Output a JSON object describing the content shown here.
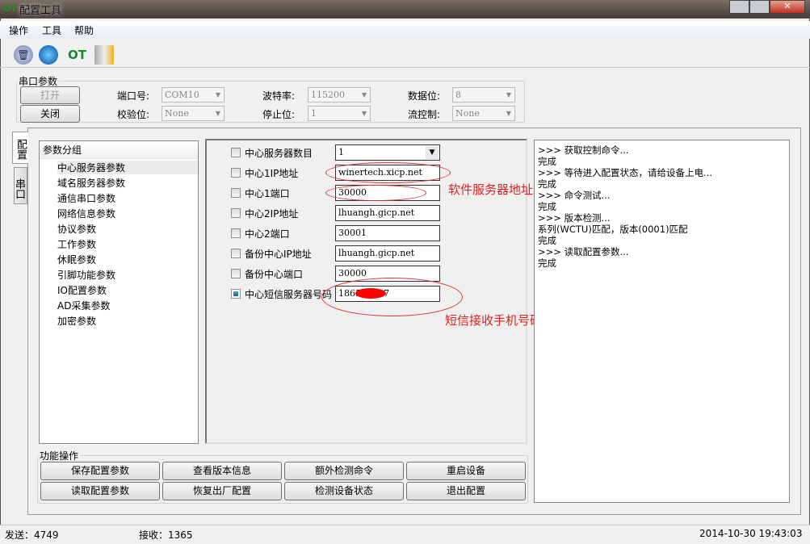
{
  "window": {
    "title": "配置工具",
    "icon": "ot-logo-icon"
  },
  "menu": [
    "操作",
    "工具",
    "帮助"
  ],
  "toolbar": [
    {
      "icon": "trash-icon"
    },
    {
      "icon": "refresh-icon"
    },
    {
      "icon": "ot-logo-icon"
    },
    {
      "icon": "database-config-icon"
    }
  ],
  "serial": {
    "legend": "串口参数",
    "open": "打开",
    "close": "关闭",
    "port_label": "端口号:",
    "port": "COM10",
    "baud_label": "波特率:",
    "baud": "115200",
    "databits_label": "数据位:",
    "databits": "8",
    "parity_label": "校验位:",
    "parity": "None",
    "stopbits_label": "停止位:",
    "stopbits": "1",
    "flow_label": "流控制:",
    "flow": "None"
  },
  "tabs": [
    "配置",
    "串口"
  ],
  "tree": {
    "header": "参数分组",
    "items": [
      "中心服务器参数",
      "域名服务器参数",
      "通信串口参数",
      "网络信息参数",
      "协议参数",
      "工作参数",
      "休眠参数",
      "引脚功能参数",
      "IO配置参数",
      "AD采集参数",
      "加密参数"
    ]
  },
  "params": [
    {
      "label": "中心服务器数目",
      "value": "1",
      "checked": false,
      "type": "select"
    },
    {
      "label": "中心1IP地址",
      "value": "winertech.xicp.net",
      "checked": false
    },
    {
      "label": "中心1端口",
      "value": "30000",
      "checked": false
    },
    {
      "label": "中心2IP地址",
      "value": "lhuangh.gicp.net",
      "checked": false
    },
    {
      "label": "中心2端口",
      "value": "30001",
      "checked": false
    },
    {
      "label": "备份中心IP地址",
      "value": "lhuangh.gicp.net",
      "checked": false
    },
    {
      "label": "备份中心端口",
      "value": "30000",
      "checked": false
    },
    {
      "label": "中心短信服务器号码",
      "value": "1865      57",
      "checked": true
    }
  ],
  "annotations": {
    "server": "软件服务器地址端口",
    "sms": "短信接收手机号码",
    "color": "#e02020"
  },
  "log": [
    ">>> 获取控制命令...",
    "完成",
    ">>> 等待进入配置状态，请给设备上电...",
    "完成",
    ">>> 命令测试...",
    "完成",
    ">>> 版本检测...",
    "系列(WCTU)匹配，版本(0001)匹配",
    "完成",
    ">>> 读取配置参数...",
    "完成"
  ],
  "functions": {
    "legend": "功能操作",
    "buttons": [
      "保存配置参数",
      "查看版本信息",
      "额外检测命令",
      "重启设备",
      "读取配置参数",
      "恢复出厂配置",
      "检测设备状态",
      "退出配置"
    ]
  },
  "status": {
    "sent": "发送：4749",
    "received": "接收：1365",
    "datetime": "2014-10-30 19:43:03"
  }
}
